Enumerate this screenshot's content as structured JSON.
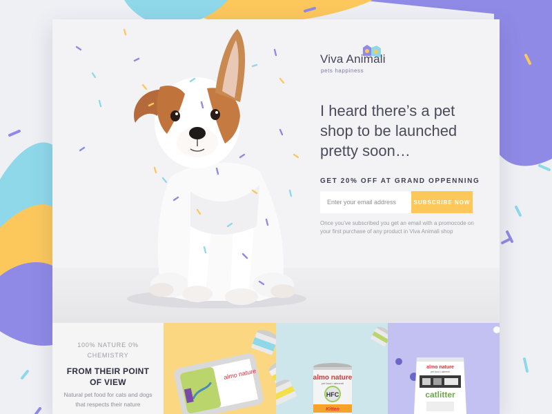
{
  "brand": {
    "name": "Viva Animali",
    "tagline": "pets happiness"
  },
  "hero": {
    "headline": "I heard there’s a pet shop to be launched pretty soon…",
    "promo_label": "GET 20% OFF AT GRAND OPPENNING",
    "email_placeholder": "Enter your email address",
    "subscribe_label": "SUBSCRIBE NOW",
    "disclaimer": "Once you’ve subscribed you get an email with a promocode on your first purchase of any product in Viva Animali shop"
  },
  "features": {
    "nature_label": "100% NATURE 0% CHEMISTRY",
    "title": "FROM THEIR POINT OF VIEW",
    "description": "Natural pet food for cats and dogs that respects their nature"
  },
  "products": {
    "tray_brand": "almo nature",
    "can_brand": "almo nature",
    "can_sublabel": "pet food • alimenti",
    "can_badge": "HFC",
    "can_flavor": "Kitten",
    "bag_brand": "almo nature",
    "bag_sublabel": "pet food • alimenti",
    "bag_product": "catlitter"
  },
  "colors": {
    "subscribe_bg": "#fdc85a",
    "panel_yellow": "#fcd781",
    "panel_blue": "#cde6ec",
    "panel_purple": "#c3c0f2",
    "bg_purple": "#8e8ae6",
    "bg_yellow": "#fcc85c",
    "bg_cyan": "#8ed8ea",
    "brand_red": "#e5303a"
  }
}
